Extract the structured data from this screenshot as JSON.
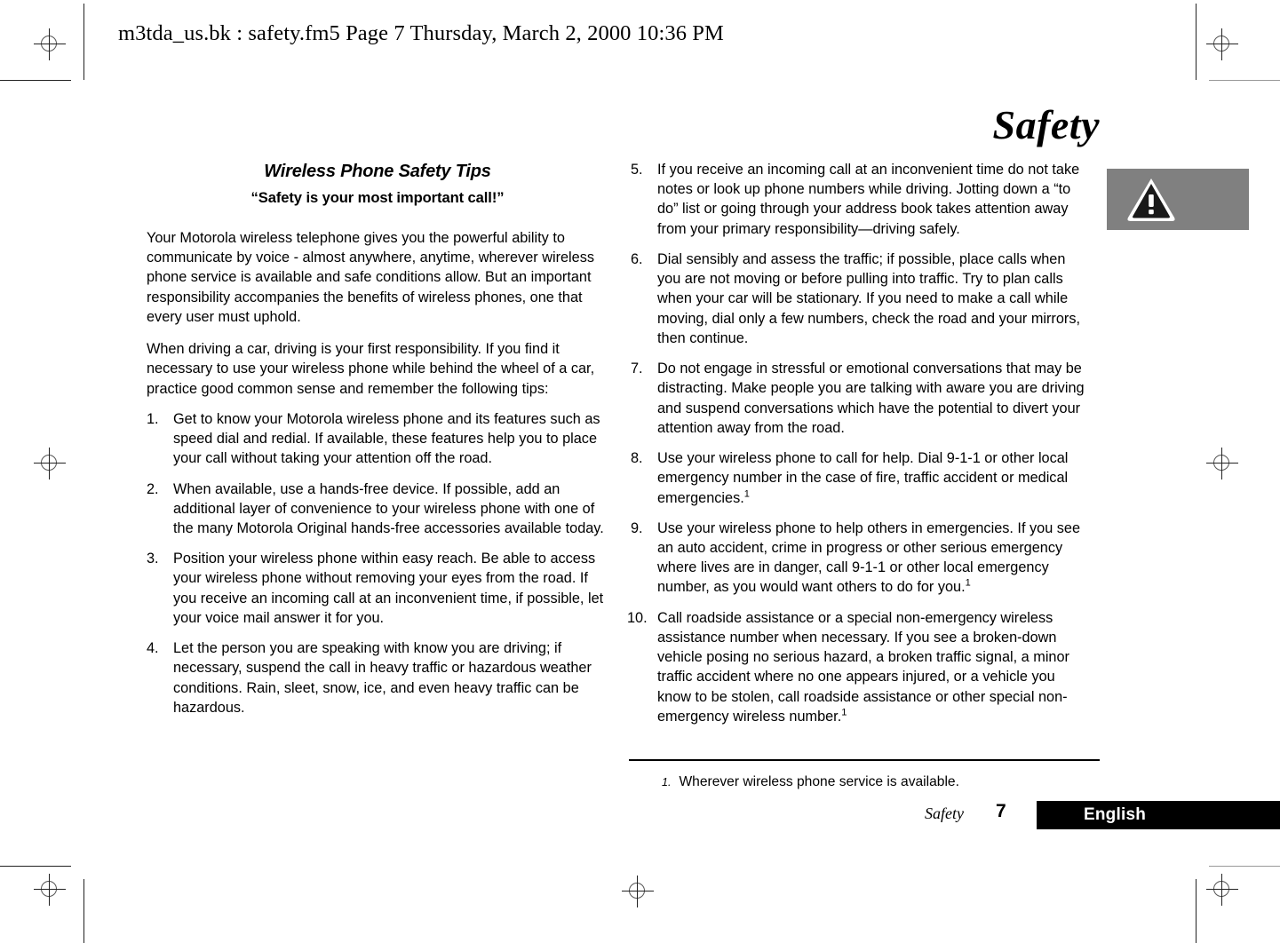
{
  "printer_slug": "m3tda_us.bk : safety.fm5  Page 7  Thursday, March 2, 2000  10:36 PM",
  "chapter": {
    "running_head": "Safety",
    "footer_chapter": "Safety",
    "page_number": "7",
    "language": "English"
  },
  "warning": {
    "icon": "warning-triangle-icon",
    "box_color": "#808080"
  },
  "section": {
    "heading": "Wireless Phone Safety Tips",
    "subheading": "“Safety is your most important call!”"
  },
  "intro_paragraphs": [
    "Your Motorola wireless telephone gives you the powerful ability to communicate by voice - almost anywhere, anytime, wherever wireless phone service is available and safe conditions allow. But an important responsibility accompanies the benefits of wireless phones, one that every user must uphold.",
    "When driving a car, driving is your first responsibility. If you find it necessary to use your wireless phone while behind the wheel of a car, practice good common sense and remember the following tips:"
  ],
  "tips_left": [
    {
      "num": "1.",
      "text": "Get to know your Motorola wireless phone and its features such as speed dial and redial. If available, these features help you to place your call without taking your attention off the road."
    },
    {
      "num": "2.",
      "text": "When available, use a hands-free device. If possible, add an additional layer of convenience to your wireless phone with one of the many Motorola Original hands-free accessories available today."
    },
    {
      "num": "3.",
      "text": "Position your wireless phone within easy reach. Be able to access your wireless phone without removing your eyes from the road. If you receive an incoming call at an inconvenient time, if possible, let your voice mail answer it for you."
    },
    {
      "num": "4.",
      "text": "Let the person you are speaking with know you are driving; if necessary, suspend the call in heavy traffic or hazardous weather conditions. Rain, sleet, snow, ice, and even heavy traffic can be hazardous."
    }
  ],
  "tips_right": [
    {
      "num": "5.",
      "text": "If you receive an incoming call at an inconvenient time do not take notes or look up phone numbers while driving. Jotting down a “to do” list or going through your address book takes attention away from your primary responsibility—driving safely.",
      "footnote_marker": ""
    },
    {
      "num": "6.",
      "text": "Dial sensibly and assess the traffic; if possible, place calls when you are not moving or before pulling into traffic. Try to plan calls when your car will be stationary. If you need to make a call while moving, dial only a few numbers, check the road and your mirrors, then continue.",
      "footnote_marker": ""
    },
    {
      "num": "7.",
      "text": "Do not engage in stressful or emotional conversations that may be distracting. Make people you are talking with aware you are driving and suspend conversations which have the potential to divert your attention away from the road.",
      "footnote_marker": ""
    },
    {
      "num": "8.",
      "text": "Use your wireless phone to call for help. Dial 9-1-1 or other local emergency number in the case of fire, traffic accident or medical emergencies.",
      "footnote_marker": "1"
    },
    {
      "num": "9.",
      "text": "Use your wireless phone to help others in emergencies. If you see an auto accident, crime in progress or other serious emergency where lives are in danger, call 9-1-1 or other local emergency number, as you would want others to do for you.",
      "footnote_marker": "1"
    },
    {
      "num": "10.",
      "text": "Call roadside assistance or a special non-emergency wireless assistance number when necessary. If you see a broken-down vehicle posing no serious hazard, a broken traffic signal, a minor traffic accident where no one appears injured, or a vehicle you know to be stolen, call roadside assistance or other special non-emergency wireless number.",
      "footnote_marker": "1"
    }
  ],
  "footnote": {
    "marker": "1.",
    "text": "Wherever wireless phone service is available."
  }
}
